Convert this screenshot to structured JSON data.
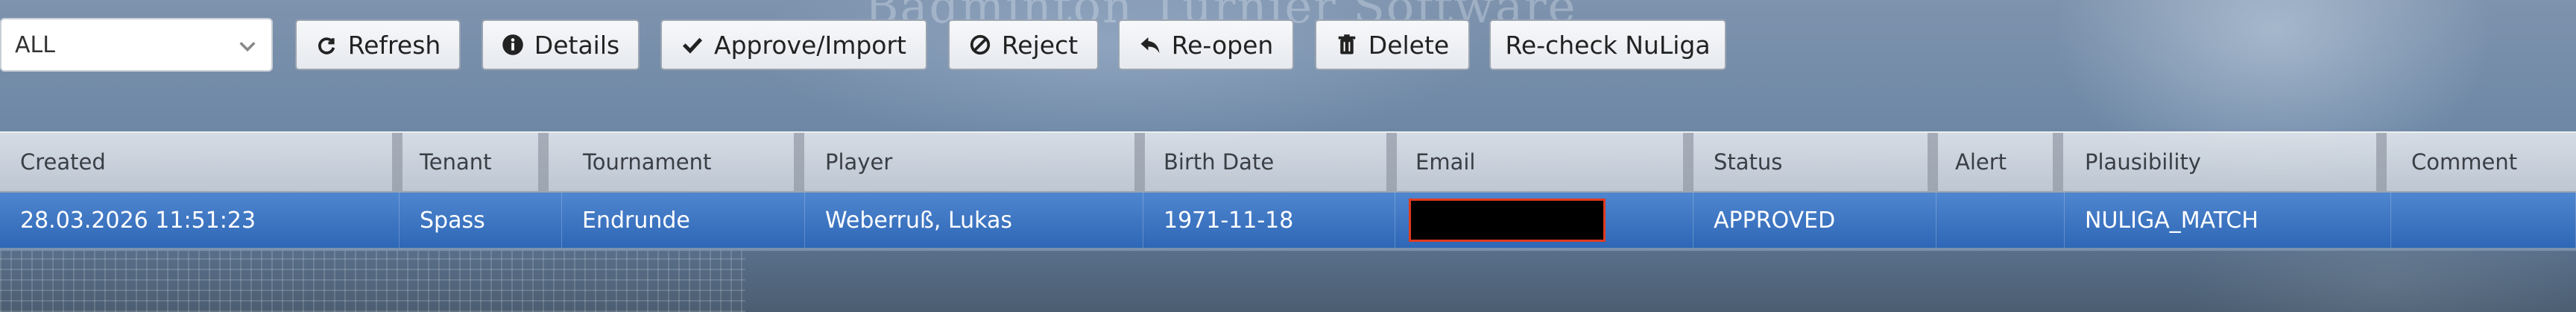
{
  "filter": {
    "value": "ALL"
  },
  "toolbar": {
    "refresh": "Refresh",
    "details": "Details",
    "approve": "Approve/Import",
    "reject": "Reject",
    "reopen": "Re-open",
    "delete": "Delete",
    "recheck": "Re-check NuLiga"
  },
  "background_text": "Badminton Turnier Software",
  "table": {
    "columns": [
      "Created",
      "Tenant",
      "Tournament",
      "Player",
      "Birth Date",
      "Email",
      "Status",
      "Alert",
      "Plausibility",
      "Comment"
    ],
    "rows": [
      {
        "created": "28.03.2026 11:51:23",
        "tenant": "Spass",
        "tournament": "Endrunde",
        "player": "Weberruß, Lukas",
        "birth_date": "1971-11-18",
        "email": "",
        "status": "APPROVED",
        "alert": "",
        "plausibility": "NULIGA_MATCH",
        "comment": ""
      }
    ]
  },
  "colors": {
    "selected_row": "#3a74c4",
    "redaction_border": "#e03a1e"
  }
}
